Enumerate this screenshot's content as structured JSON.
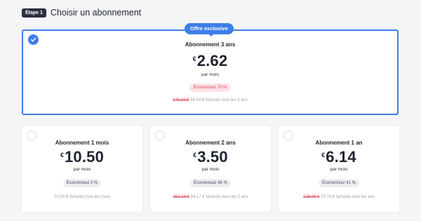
{
  "header": {
    "step": "Étape 1",
    "title": "Choisir un abonnement"
  },
  "colors": {
    "accent": "#3d7fe8",
    "discount": "#e0485d",
    "background": "#f4f5f7"
  },
  "featured_plan": {
    "badge": "Offre exclusive",
    "selected": true,
    "title": "Abonnement 3 ans",
    "currency": "€",
    "price": "2.62",
    "period": "par mois",
    "savings": "Économisez 75 %",
    "old_price": "378.19 €",
    "billing": "94.54 € facturés tous les 3 ans"
  },
  "plans": [
    {
      "title": "Abonnement 1 mois",
      "currency": "€",
      "price": "10.50",
      "period": "par mois",
      "savings": "Économisez 0 %",
      "old_price": "",
      "billing": "10.50 € facturés tous les mois"
    },
    {
      "title": "Abonnement 2 ans",
      "currency": "€",
      "price": "3.50",
      "period": "par mois",
      "savings": "Économisez 66 %",
      "old_price": "252.13 €",
      "billing": "84.17 € facturés tous les 2 ans"
    },
    {
      "title": "Abonnement 1 an",
      "currency": "€",
      "price": "6.14",
      "period": "par mois",
      "savings": "Économisez 41 %",
      "old_price": "126.06 €",
      "billing": "73.74 € facturés tous les ans"
    }
  ]
}
